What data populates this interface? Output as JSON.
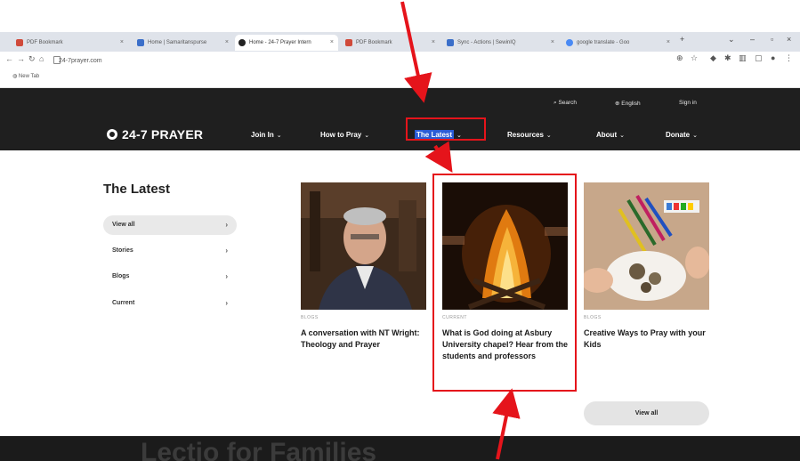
{
  "browser": {
    "tabs": [
      {
        "label": "PDF Bookmark",
        "color": "#d04a3a"
      },
      {
        "label": "Home | Samaritanspurse",
        "color": "#3b6fc9"
      },
      {
        "label": "Home - 24-7 Prayer Intern",
        "color": "#222222"
      },
      {
        "label": "PDF Bookmark",
        "color": "#d04a3a"
      },
      {
        "label": "Sync - Actions | SewinIQ",
        "color": "#3b6fc9"
      },
      {
        "label": "google translate - Goo",
        "color": "#4a8af4"
      }
    ],
    "url": "24-7prayer.com",
    "bookmark": "New Tab"
  },
  "site": {
    "logo": "24-7 PRAYER",
    "utility": {
      "search": "Search",
      "language": "English",
      "signin": "Sign in"
    },
    "nav": [
      "Join In",
      "How to Pray",
      "The Latest",
      "Resources",
      "About",
      "Donate"
    ]
  },
  "latest": {
    "title": "The Latest",
    "sidebar": [
      {
        "label": "View all",
        "active": true
      },
      {
        "label": "Stories",
        "active": false
      },
      {
        "label": "Blogs",
        "active": false
      },
      {
        "label": "Current",
        "active": false
      }
    ],
    "cards": [
      {
        "category": "BLOGS",
        "title": "A conversation with NT Wright: Theology and Prayer",
        "image": "portrait-photo"
      },
      {
        "category": "CURRENT",
        "title": "What is God doing at Asbury University chapel? Hear from the students and professors",
        "image": "fire-photo"
      },
      {
        "category": "BLOGS",
        "title": "Creative Ways to Pray with your Kids",
        "image": "craft-photo"
      }
    ],
    "view_all": "View all"
  },
  "banner": {
    "text": "Lectio for Families"
  },
  "colors": {
    "header_bg": "#1f1f1f",
    "highlight": "#2b5cd6",
    "annotation_red": "#e5141b"
  }
}
